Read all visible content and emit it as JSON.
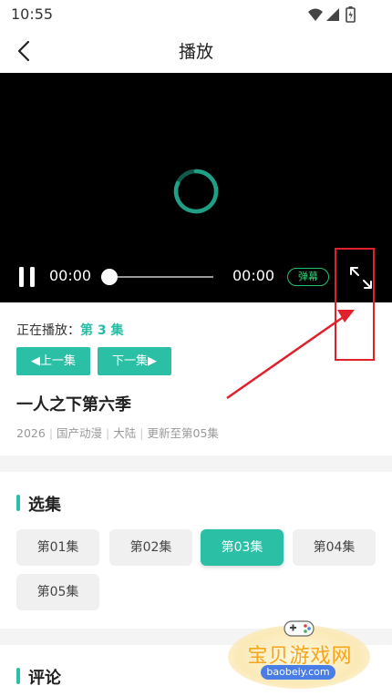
{
  "status_bar": {
    "time": "10:55",
    "icons": [
      "wifi-icon",
      "signal-icon",
      "battery-icon"
    ]
  },
  "app_bar": {
    "title": "播放",
    "back_icon": "back-arrow-icon"
  },
  "player": {
    "current_time": "00:00",
    "total_time": "00:00",
    "progress": 0,
    "danmaku_label": "弹幕",
    "state": "loading",
    "accent_color": "#27c26c"
  },
  "info": {
    "now_playing_label": "正在播放：",
    "now_playing_episode": "第 3 集",
    "prev_label": "◀上一集",
    "next_label": "下一集▶",
    "show_title": "一人之下第六季",
    "meta": [
      "2026",
      "国产动漫",
      "大陆",
      "更新至第05集"
    ]
  },
  "episodes": {
    "title": "选集",
    "items": [
      "第01集",
      "第02集",
      "第03集",
      "第04集",
      "第05集"
    ],
    "active_index": 2
  },
  "comments": {
    "title": "评论"
  },
  "watermark": {
    "text": "宝贝游戏网",
    "url": "baobeiy.com"
  },
  "colors": {
    "accent": "#2bbfa6",
    "annotation": "#e0202a"
  }
}
